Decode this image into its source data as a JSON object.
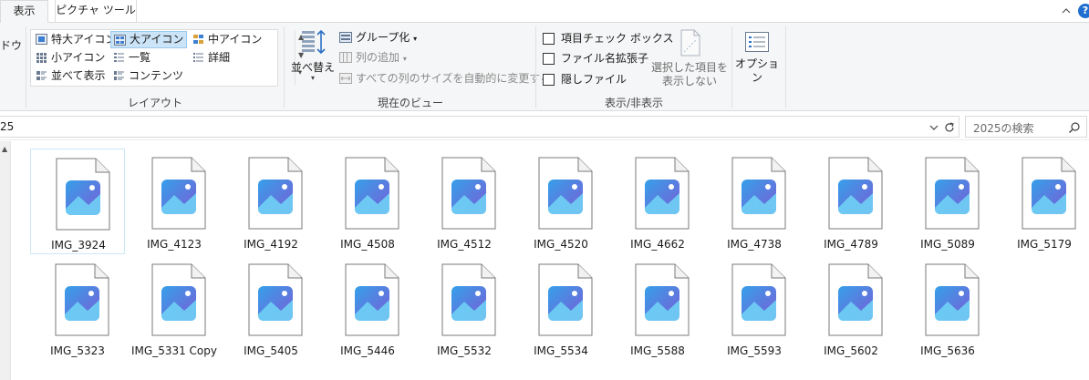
{
  "tabs": {
    "view": "表示",
    "picture_tools": "ピクチャ ツール"
  },
  "ribbon": {
    "pane_fragment": "ドウ",
    "layout": {
      "items": [
        "特大アイコン",
        "大アイコン",
        "中アイコン",
        "小アイコン",
        "一覧",
        "詳細",
        "並べて表示",
        "コンテンツ"
      ],
      "selected": "大アイコン",
      "group_label": "レイアウト"
    },
    "current_view": {
      "sort_label": "並べ替え",
      "group_by": "グループ化",
      "add_column": "列の追加",
      "fit_columns": "すべての列のサイズを自動的に変更する",
      "group_label": "現在のビュー"
    },
    "show_hide": {
      "item_checkboxes": "項目チェック ボックス",
      "file_extensions": "ファイル名拡張子",
      "hidden_items": "隠しファイル",
      "hide_selected_line1": "選択した項目を",
      "hide_selected_line2": "表示しない",
      "group_label": "表示/非表示"
    },
    "options_label": "オプション"
  },
  "address": {
    "path_fragment": "25",
    "search_placeholder": "2025の検索"
  },
  "files": [
    "IMG_3924",
    "IMG_4123",
    "IMG_4192",
    "IMG_4508",
    "IMG_4512",
    "IMG_4520",
    "IMG_4662",
    "IMG_4738",
    "IMG_4789",
    "IMG_5089",
    "IMG_5179",
    "IMG_5323",
    "IMG_5331 Copy",
    "IMG_5405",
    "IMG_5446",
    "IMG_5532",
    "IMG_5534",
    "IMG_5588",
    "IMG_5593",
    "IMG_5602",
    "IMG_5636"
  ],
  "selected_file": "IMG_3924",
  "colors": {
    "accent": "#1f6fd0",
    "selection": "#cce4f7",
    "ribbon_bg": "#f5f6f7",
    "photo_icon_a": "#2e86de",
    "photo_icon_b": "#7b5cd6"
  },
  "icons": {
    "file": "image-file-icon",
    "help": "help-icon",
    "search": "search-icon",
    "refresh": "refresh-icon"
  }
}
